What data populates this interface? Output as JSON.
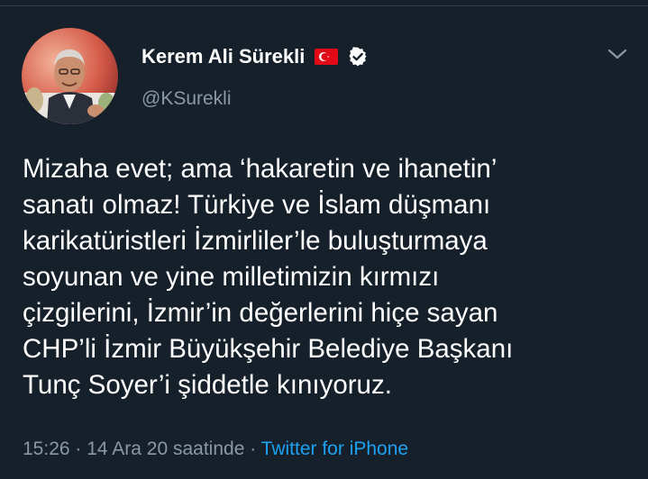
{
  "tweet": {
    "author": {
      "display_name": "Kerem Ali Sürekli",
      "handle": "@KSurekli",
      "verified": true,
      "flag": "turkey-flag"
    },
    "text_lines": [
      "Mizaha evet; ama ‘hakaretin ve ihanetin’",
      "sanatı olmaz! Türkiye ve İslam düşmanı",
      "karikatüristleri İzmirliler’le buluşturmaya",
      "soyunan ve yine milletimizin kırmızı",
      "çizgilerini, İzmir’in değerlerini hiçe sayan",
      "CHP’li İzmir Büyükşehir Belediye Başkanı",
      "Tunç Soyer’i şiddetle kınıyoruz."
    ],
    "meta": {
      "time": "15:26",
      "sep1": " · ",
      "date": "14 Ara 20 saatinde",
      "sep2": " · ",
      "source": "Twitter for iPhone"
    }
  },
  "icons": {
    "more": "chevron-down-icon",
    "verified": "verified-badge-icon",
    "flag": "turkey-flag-icon"
  },
  "colors": {
    "background": "#15202b",
    "primary_text": "#ffffff",
    "secondary_text": "#8b98a5",
    "link": "#1da1f2",
    "flag_red": "#e30a17"
  }
}
